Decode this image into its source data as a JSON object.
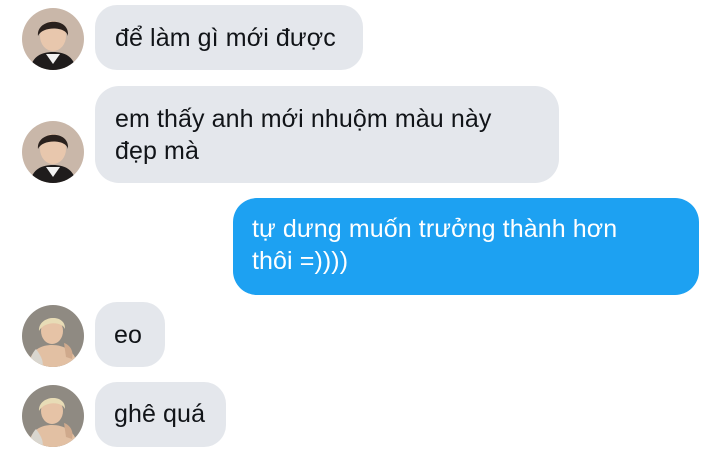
{
  "conversation": {
    "messages": [
      {
        "sender": "contact",
        "avatar": "avatar-dark-hair",
        "lines": [
          "để làm gì mới được"
        ]
      },
      {
        "sender": "contact",
        "avatar": "avatar-dark-hair",
        "lines": [
          "em thấy anh mới nhuộm màu này",
          "đẹp mà"
        ]
      },
      {
        "sender": "me",
        "lines": [
          "tự dưng muốn trưởng thành hơn",
          "thôi =))))"
        ]
      },
      {
        "sender": "contact",
        "avatar": "avatar-blonde-hair",
        "lines": [
          "eo"
        ]
      },
      {
        "sender": "contact",
        "avatar": "avatar-blonde-hair",
        "lines": [
          "ghê quá"
        ]
      }
    ]
  },
  "colors": {
    "incoming_bubble": "#e4e7ec",
    "outgoing_bubble": "#1da1f2",
    "incoming_text": "#111418",
    "outgoing_text": "#ffffff"
  }
}
